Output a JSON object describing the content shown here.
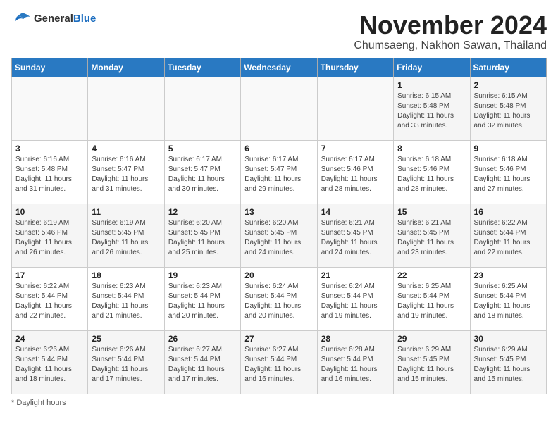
{
  "header": {
    "logo_general": "General",
    "logo_blue": "Blue",
    "month": "November 2024",
    "location": "Chumsaeng, Nakhon Sawan, Thailand"
  },
  "days_of_week": [
    "Sunday",
    "Monday",
    "Tuesday",
    "Wednesday",
    "Thursday",
    "Friday",
    "Saturday"
  ],
  "weeks": [
    [
      {
        "day": "",
        "info": ""
      },
      {
        "day": "",
        "info": ""
      },
      {
        "day": "",
        "info": ""
      },
      {
        "day": "",
        "info": ""
      },
      {
        "day": "",
        "info": ""
      },
      {
        "day": "1",
        "info": "Sunrise: 6:15 AM\nSunset: 5:48 PM\nDaylight: 11 hours and 33 minutes."
      },
      {
        "day": "2",
        "info": "Sunrise: 6:15 AM\nSunset: 5:48 PM\nDaylight: 11 hours and 32 minutes."
      }
    ],
    [
      {
        "day": "3",
        "info": "Sunrise: 6:16 AM\nSunset: 5:48 PM\nDaylight: 11 hours and 31 minutes."
      },
      {
        "day": "4",
        "info": "Sunrise: 6:16 AM\nSunset: 5:47 PM\nDaylight: 11 hours and 31 minutes."
      },
      {
        "day": "5",
        "info": "Sunrise: 6:17 AM\nSunset: 5:47 PM\nDaylight: 11 hours and 30 minutes."
      },
      {
        "day": "6",
        "info": "Sunrise: 6:17 AM\nSunset: 5:47 PM\nDaylight: 11 hours and 29 minutes."
      },
      {
        "day": "7",
        "info": "Sunrise: 6:17 AM\nSunset: 5:46 PM\nDaylight: 11 hours and 28 minutes."
      },
      {
        "day": "8",
        "info": "Sunrise: 6:18 AM\nSunset: 5:46 PM\nDaylight: 11 hours and 28 minutes."
      },
      {
        "day": "9",
        "info": "Sunrise: 6:18 AM\nSunset: 5:46 PM\nDaylight: 11 hours and 27 minutes."
      }
    ],
    [
      {
        "day": "10",
        "info": "Sunrise: 6:19 AM\nSunset: 5:46 PM\nDaylight: 11 hours and 26 minutes."
      },
      {
        "day": "11",
        "info": "Sunrise: 6:19 AM\nSunset: 5:45 PM\nDaylight: 11 hours and 26 minutes."
      },
      {
        "day": "12",
        "info": "Sunrise: 6:20 AM\nSunset: 5:45 PM\nDaylight: 11 hours and 25 minutes."
      },
      {
        "day": "13",
        "info": "Sunrise: 6:20 AM\nSunset: 5:45 PM\nDaylight: 11 hours and 24 minutes."
      },
      {
        "day": "14",
        "info": "Sunrise: 6:21 AM\nSunset: 5:45 PM\nDaylight: 11 hours and 24 minutes."
      },
      {
        "day": "15",
        "info": "Sunrise: 6:21 AM\nSunset: 5:45 PM\nDaylight: 11 hours and 23 minutes."
      },
      {
        "day": "16",
        "info": "Sunrise: 6:22 AM\nSunset: 5:44 PM\nDaylight: 11 hours and 22 minutes."
      }
    ],
    [
      {
        "day": "17",
        "info": "Sunrise: 6:22 AM\nSunset: 5:44 PM\nDaylight: 11 hours and 22 minutes."
      },
      {
        "day": "18",
        "info": "Sunrise: 6:23 AM\nSunset: 5:44 PM\nDaylight: 11 hours and 21 minutes."
      },
      {
        "day": "19",
        "info": "Sunrise: 6:23 AM\nSunset: 5:44 PM\nDaylight: 11 hours and 20 minutes."
      },
      {
        "day": "20",
        "info": "Sunrise: 6:24 AM\nSunset: 5:44 PM\nDaylight: 11 hours and 20 minutes."
      },
      {
        "day": "21",
        "info": "Sunrise: 6:24 AM\nSunset: 5:44 PM\nDaylight: 11 hours and 19 minutes."
      },
      {
        "day": "22",
        "info": "Sunrise: 6:25 AM\nSunset: 5:44 PM\nDaylight: 11 hours and 19 minutes."
      },
      {
        "day": "23",
        "info": "Sunrise: 6:25 AM\nSunset: 5:44 PM\nDaylight: 11 hours and 18 minutes."
      }
    ],
    [
      {
        "day": "24",
        "info": "Sunrise: 6:26 AM\nSunset: 5:44 PM\nDaylight: 11 hours and 18 minutes."
      },
      {
        "day": "25",
        "info": "Sunrise: 6:26 AM\nSunset: 5:44 PM\nDaylight: 11 hours and 17 minutes."
      },
      {
        "day": "26",
        "info": "Sunrise: 6:27 AM\nSunset: 5:44 PM\nDaylight: 11 hours and 17 minutes."
      },
      {
        "day": "27",
        "info": "Sunrise: 6:27 AM\nSunset: 5:44 PM\nDaylight: 11 hours and 16 minutes."
      },
      {
        "day": "28",
        "info": "Sunrise: 6:28 AM\nSunset: 5:44 PM\nDaylight: 11 hours and 16 minutes."
      },
      {
        "day": "29",
        "info": "Sunrise: 6:29 AM\nSunset: 5:45 PM\nDaylight: 11 hours and 15 minutes."
      },
      {
        "day": "30",
        "info": "Sunrise: 6:29 AM\nSunset: 5:45 PM\nDaylight: 11 hours and 15 minutes."
      }
    ]
  ],
  "footer": {
    "note": "Daylight hours"
  }
}
